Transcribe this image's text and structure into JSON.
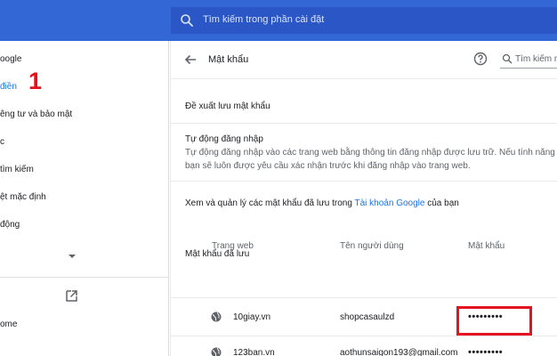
{
  "search": {
    "placeholder": "Tìm kiếm trong phần cài đặt"
  },
  "sidebar": {
    "items": [
      {
        "label": "oogle"
      },
      {
        "label": "điền",
        "active": true
      },
      {
        "label": "êng tư và bảo mật"
      },
      {
        "label": "c"
      },
      {
        "label": "tìm kiếm"
      },
      {
        "label": "ệt mặc định"
      },
      {
        "label": "động"
      },
      {
        "label": "ome"
      }
    ]
  },
  "annotation": {
    "number": "1",
    "color": "#e3131f"
  },
  "passwords": {
    "title": "Mật khẩu",
    "search_placeholder": "Tìm kiếm m",
    "offer_to_save": "Đề xuất lưu mật khẩu",
    "auto_signin": {
      "title": "Tự động đăng nhập",
      "desc_line1": "Tự động đăng nhập vào các trang web bằng thông tin đăng nhập được lưu trữ. Nếu tính năng n",
      "desc_line2": "bạn sẽ luôn được yêu cầu xác nhận trước khi đăng nhập vào trang web."
    },
    "manage": {
      "prefix": "Xem và quản lý các mật khẩu đã lưu trong ",
      "link": "Tài khoản Google",
      "suffix": " của bạn"
    },
    "saved_title": "Mật khẩu đã lưu",
    "columns": [
      "Trang web",
      "Tên người dùng",
      "Mật khẩu"
    ],
    "rows": [
      {
        "site": "10giay.vn",
        "user": "shopcasaulzd",
        "password": "•••••••••"
      },
      {
        "site": "123ban.vn",
        "user": "aothunsaigon193@gmail.com",
        "password": "•••••••••"
      }
    ]
  },
  "colors": {
    "topbar": "#3367d6",
    "accent": "#1a73e8",
    "highlight": "#e3131f"
  },
  "icons": [
    "search-icon",
    "back-arrow-icon",
    "help-icon",
    "globe-icon",
    "external-link-icon",
    "chevron-down-icon"
  ]
}
